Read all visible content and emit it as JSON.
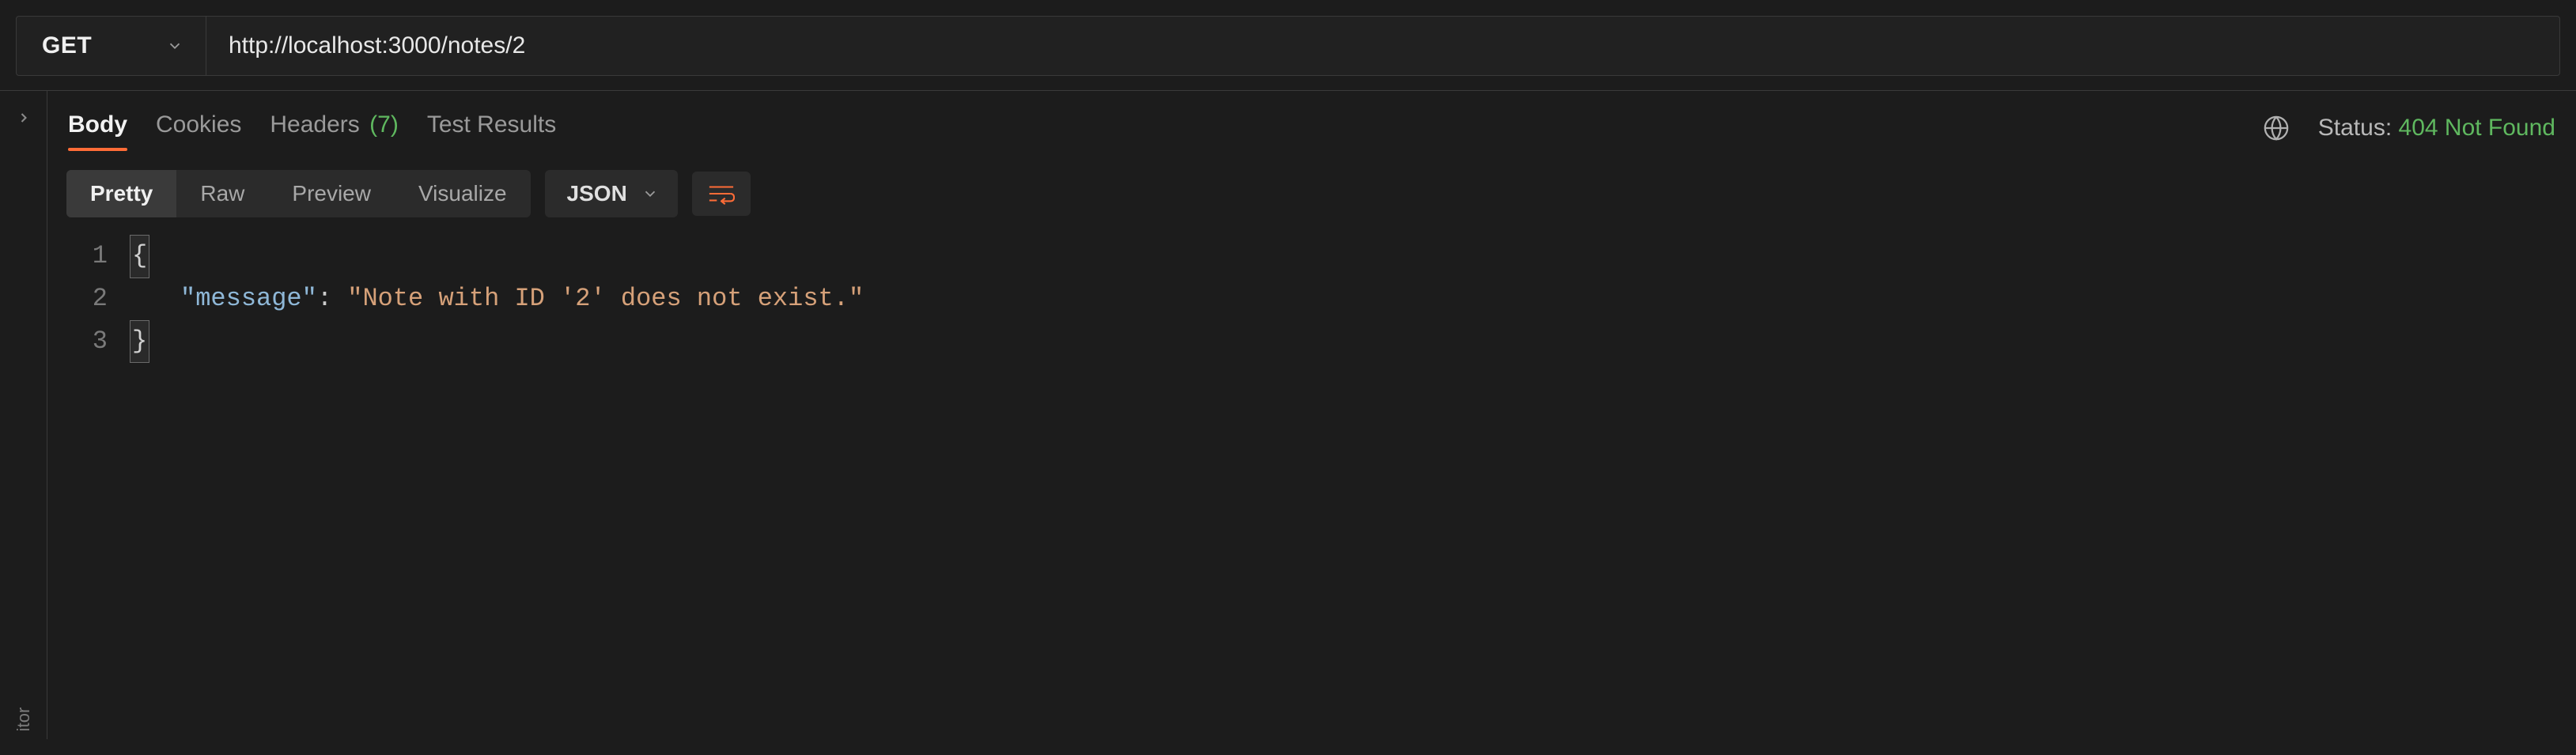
{
  "request": {
    "method": "GET",
    "url": "http://localhost:3000/notes/2"
  },
  "gutter": {
    "vertical_label": "itor"
  },
  "response_tabs": {
    "body": "Body",
    "cookies": "Cookies",
    "headers": "Headers",
    "headers_count": "(7)",
    "test_results": "Test Results"
  },
  "status": {
    "label": "Status:",
    "value": "404 Not Found"
  },
  "view_modes": {
    "pretty": "Pretty",
    "raw": "Raw",
    "preview": "Preview",
    "visualize": "Visualize"
  },
  "format_select": {
    "label": "JSON"
  },
  "code": {
    "line1_num": "1",
    "line1_text": "{",
    "line2_num": "2",
    "line2_key": "\"message\"",
    "line2_colon": ":",
    "line2_value": "\"Note with ID '2' does not exist.\"",
    "line3_num": "3",
    "line3_text": "}"
  }
}
